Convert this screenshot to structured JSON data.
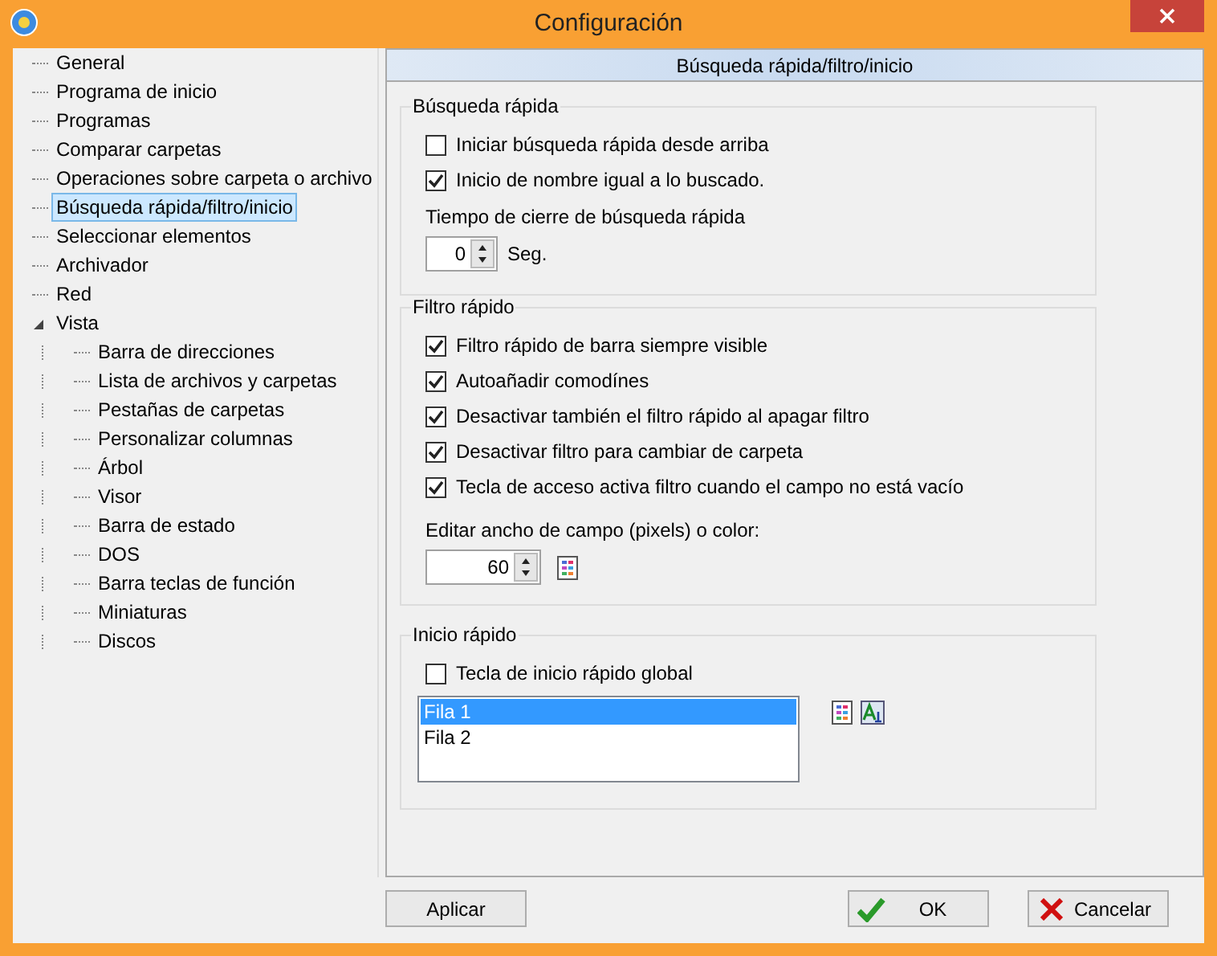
{
  "window": {
    "title": "Configuración"
  },
  "tree": {
    "items": [
      {
        "label": "General",
        "selected": false
      },
      {
        "label": "Programa de inicio",
        "selected": false
      },
      {
        "label": "Programas",
        "selected": false
      },
      {
        "label": "Comparar carpetas",
        "selected": false
      },
      {
        "label": "Operaciones sobre carpeta o archivo",
        "selected": false
      },
      {
        "label": "Búsqueda rápida/filtro/inicio",
        "selected": true
      },
      {
        "label": "Seleccionar elementos",
        "selected": false
      },
      {
        "label": "Archivador",
        "selected": false
      },
      {
        "label": "Red",
        "selected": false
      },
      {
        "label": "Vista",
        "selected": false,
        "expanded": true,
        "children": [
          {
            "label": "Barra de direcciones",
            "selected": false
          },
          {
            "label": "Lista de archivos y carpetas",
            "selected": false
          },
          {
            "label": "Pestañas de carpetas",
            "selected": false
          },
          {
            "label": "Personalizar columnas",
            "selected": false
          },
          {
            "label": "Árbol",
            "selected": false
          },
          {
            "label": "Visor",
            "selected": false
          },
          {
            "label": "Barra de estado",
            "selected": false
          },
          {
            "label": "DOS",
            "selected": false
          },
          {
            "label": "Barra teclas de función",
            "selected": false
          },
          {
            "label": "Miniaturas",
            "selected": false
          },
          {
            "label": "Discos",
            "selected": false
          }
        ]
      }
    ]
  },
  "panel": {
    "title": "Búsqueda rápida/filtro/inicio"
  },
  "quick_search": {
    "title": "Búsqueda rápida",
    "options": [
      {
        "label": "Iniciar búsqueda rápida desde arriba",
        "checked": false
      },
      {
        "label": "Inicio de nombre igual a lo buscado.",
        "checked": true
      }
    ],
    "close_time_label": "Tiempo de cierre de búsqueda rápida",
    "close_time_value": "0",
    "unit": "Seg."
  },
  "quick_filter": {
    "title": "Filtro rápido",
    "options": [
      {
        "label": "Filtro rápido de barra siempre visible",
        "checked": true
      },
      {
        "label": "Autoañadir comodínes",
        "checked": true
      },
      {
        "label": "Desactivar también el filtro rápido al apagar filtro",
        "checked": true
      },
      {
        "label": "Desactivar filtro para cambiar de carpeta",
        "checked": true
      },
      {
        "label": "Tecla de acceso activa filtro cuando el campo no está vacío",
        "checked": true
      }
    ],
    "width_label": "Editar ancho de campo (pixels) o color:",
    "width_value": "60"
  },
  "quick_start": {
    "title": "Inicio rápido",
    "options": [
      {
        "label": "Tecla de inicio rápido global",
        "checked": false
      }
    ],
    "rows": [
      {
        "label": "Fila 1",
        "selected": true
      },
      {
        "label": "Fila 2",
        "selected": false
      }
    ]
  },
  "buttons": [
    {
      "label": "Aplicar",
      "kind": "apply"
    },
    {
      "label": "OK",
      "kind": "ok"
    },
    {
      "label": "Cancelar",
      "kind": "cancel"
    }
  ]
}
